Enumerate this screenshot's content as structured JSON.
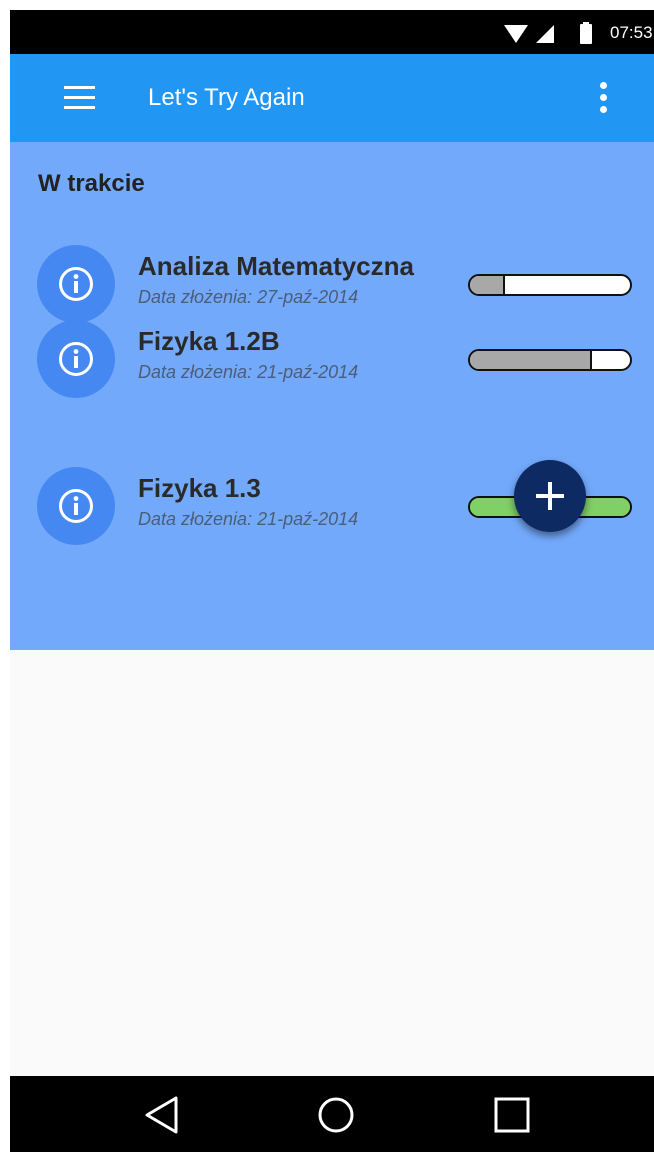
{
  "status_bar": {
    "time": "07:53",
    "icons": [
      "wifi-icon",
      "signal-icon",
      "battery-icon"
    ]
  },
  "app_bar": {
    "title": "Let's Try Again",
    "menu_icon": "hamburger-menu-icon",
    "overflow_icon": "more-vert-icon"
  },
  "section": {
    "title": "W trakcie"
  },
  "courses": [
    {
      "name": "Analiza Matematyczna",
      "date": "Data złożenia: 27-paź-2014",
      "icon": "info-icon",
      "progress": 0.22,
      "complete": false
    },
    {
      "name": "Fizyka 1.2B",
      "date": "Data złożenia: 21-paź-2014",
      "icon": "info-icon",
      "progress": 0.76,
      "complete": false
    },
    {
      "name": "Fizyka 1.3",
      "date": "Data złożenia: 21-paź-2014",
      "icon": "info-icon",
      "progress": 1.0,
      "complete": true
    }
  ],
  "fab": {
    "icon": "add-icon"
  },
  "nav_bar": {
    "icons": [
      "back-icon",
      "home-icon",
      "recents-icon"
    ]
  },
  "colors": {
    "app_bar": "#2196f3",
    "section_bg": "#73a9fb",
    "info_circle": "#4588f2",
    "progress_incomplete": "#a8a8a8",
    "progress_complete": "#7fd066",
    "fab": "#0d2a63"
  }
}
